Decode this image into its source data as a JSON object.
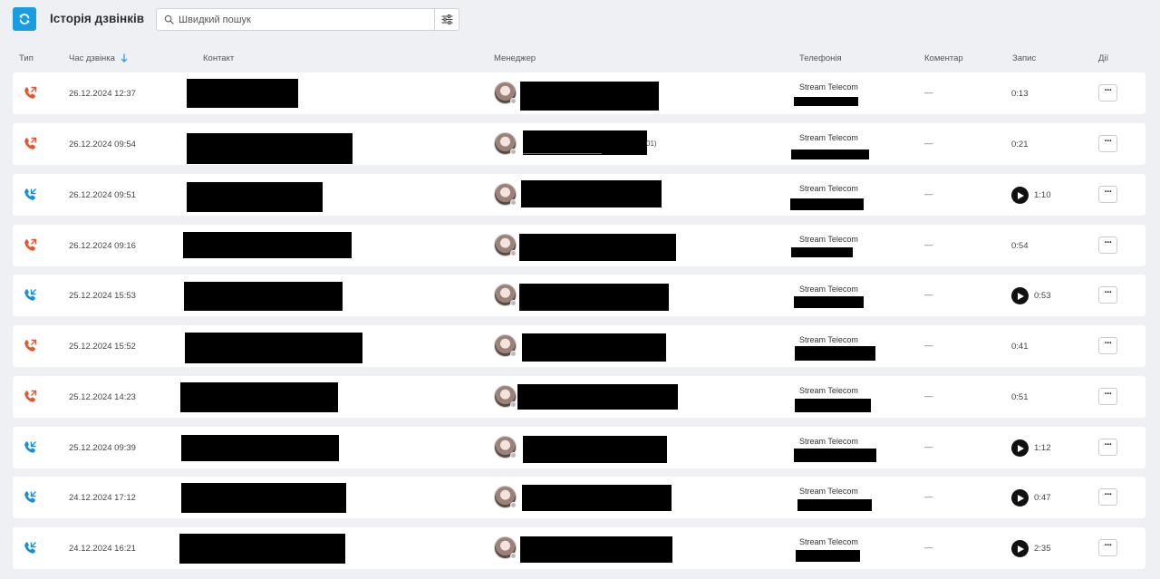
{
  "header": {
    "title": "Історія дзвінків",
    "search_placeholder": "Швидкий пошук"
  },
  "columns": {
    "type": "Тип",
    "time": "Час дзвінка",
    "contact": "Контакт",
    "manager": "Менеджер",
    "telephony": "Телефонія",
    "comment": "Коментар",
    "record": "Запис",
    "actions": "Дії"
  },
  "colors": {
    "accent": "#1a9ce3",
    "outgoing": "#e8542b",
    "incoming": "#1a8fd3"
  },
  "calls": [
    {
      "direction": "outgoing",
      "time": "26.12.2024 12:37",
      "telephony": "Stream Telecom",
      "comment": "—",
      "duration": "0:13",
      "has_record": false,
      "manager_extra": ""
    },
    {
      "direction": "outgoing",
      "time": "26.12.2024 09:54",
      "telephony": "Stream Telecom",
      "comment": "—",
      "duration": "0:21",
      "has_record": false,
      "manager_extra": "01)"
    },
    {
      "direction": "incoming",
      "time": "26.12.2024 09:51",
      "telephony": "Stream Telecom",
      "comment": "—",
      "duration": "1:10",
      "has_record": true,
      "manager_extra": ""
    },
    {
      "direction": "outgoing",
      "time": "26.12.2024 09:16",
      "telephony": "Stream Telecom",
      "comment": "—",
      "duration": "0:54",
      "has_record": false,
      "manager_extra": ""
    },
    {
      "direction": "incoming",
      "time": "25.12.2024 15:53",
      "telephony": "Stream Telecom",
      "comment": "—",
      "duration": "0:53",
      "has_record": true,
      "manager_extra": ""
    },
    {
      "direction": "outgoing",
      "time": "25.12.2024 15:52",
      "telephony": "Stream Telecom",
      "comment": "—",
      "duration": "0:41",
      "has_record": false,
      "manager_extra": ""
    },
    {
      "direction": "outgoing",
      "time": "25.12.2024 14:23",
      "telephony": "Stream Telecom",
      "comment": "—",
      "duration": "0:51",
      "has_record": false,
      "manager_extra": ""
    },
    {
      "direction": "incoming",
      "time": "25.12.2024 09:39",
      "telephony": "Stream Telecom",
      "comment": "—",
      "duration": "1:12",
      "has_record": true,
      "manager_extra": ""
    },
    {
      "direction": "incoming",
      "time": "24.12.2024 17:12",
      "telephony": "Stream Telecom",
      "comment": "—",
      "duration": "0:47",
      "has_record": true,
      "manager_extra": ""
    },
    {
      "direction": "incoming",
      "time": "24.12.2024 16:21",
      "telephony": "Stream Telecom",
      "comment": "—",
      "duration": "2:35",
      "has_record": true,
      "manager_extra": ""
    }
  ],
  "actions_label": "···"
}
